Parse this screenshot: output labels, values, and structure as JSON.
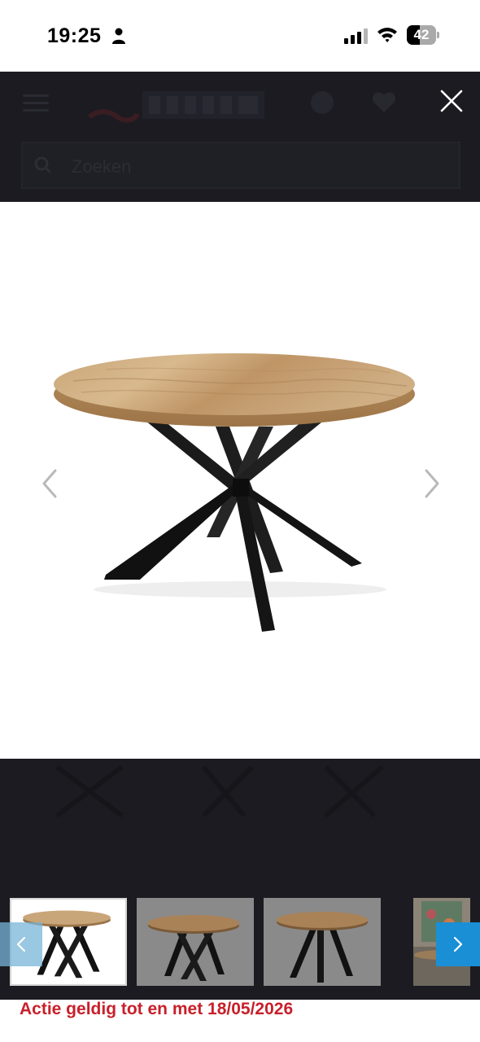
{
  "status_bar": {
    "time": "19:25",
    "battery_level": "42",
    "icons": [
      "person-icon",
      "signal-icon",
      "wifi-icon",
      "battery-icon"
    ]
  },
  "header": {
    "search_placeholder": "Zoeken",
    "icons": [
      "hamburger-icon",
      "logo",
      "user-icon",
      "heart-icon",
      "close-icon",
      "search-icon"
    ]
  },
  "gallery": {
    "main_image": "round-wooden-dining-table-black-spider-legs",
    "prev_icon": "chevron-left-icon",
    "next_icon": "chevron-right-icon",
    "thumbnails": [
      {
        "name": "thumb-table-white-background",
        "active": true
      },
      {
        "name": "thumb-table-grey-background",
        "active": false
      },
      {
        "name": "thumb-table-grey-background-2",
        "active": false
      },
      {
        "name": "thumb-table-room-setting",
        "active": false
      }
    ]
  },
  "promo": {
    "text": "Actie geldig tot en met 18/05/2026"
  },
  "colors": {
    "overlay": "#1b1b21",
    "accent_blue": "#1a8fd6",
    "promo_red": "#c8202a"
  }
}
